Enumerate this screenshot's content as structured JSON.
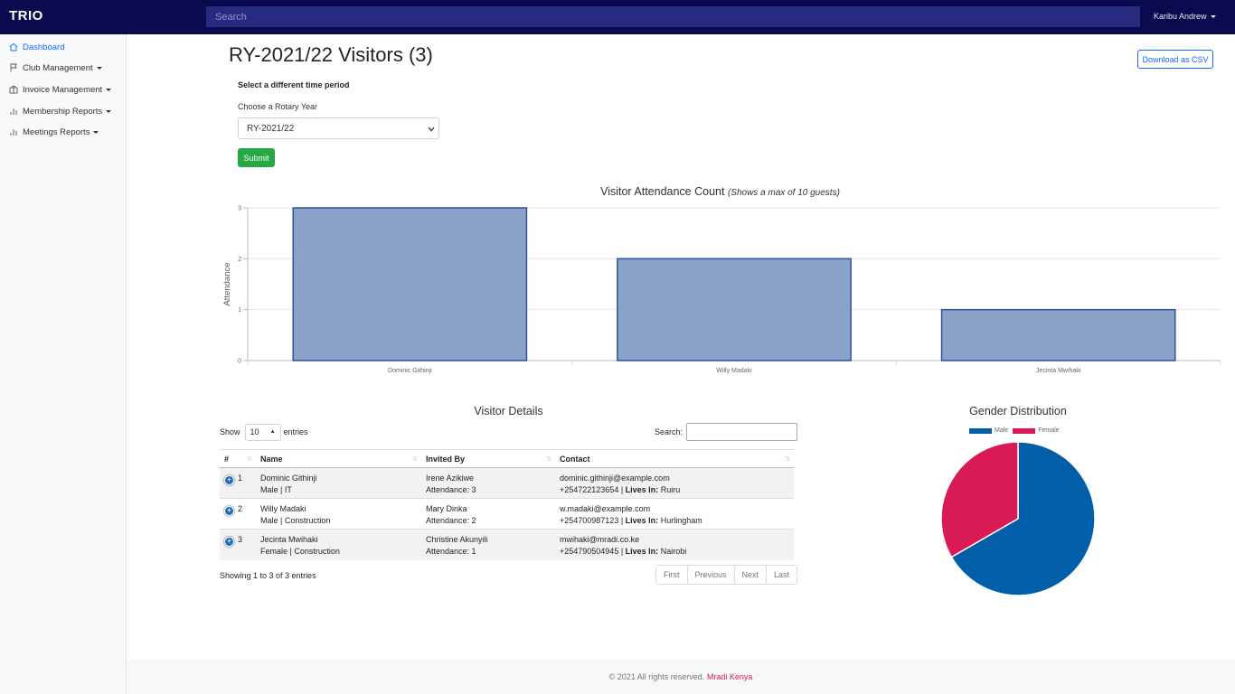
{
  "app": {
    "brand": "TRIO"
  },
  "topbar": {
    "search_placeholder": "Search",
    "user_label": "Karibu Andrew"
  },
  "sidebar": {
    "items": [
      {
        "label": "Dashboard",
        "icon": "home-icon",
        "active": true,
        "dropdown": false
      },
      {
        "label": "Club Management",
        "icon": "flag-icon",
        "active": false,
        "dropdown": true
      },
      {
        "label": "Invoice Management",
        "icon": "briefcase-icon",
        "active": false,
        "dropdown": true
      },
      {
        "label": "Membership Reports",
        "icon": "bar-chart-icon",
        "active": false,
        "dropdown": true
      },
      {
        "label": "Meetings Reports",
        "icon": "bar-chart-icon",
        "active": false,
        "dropdown": true
      }
    ]
  },
  "main": {
    "title": "RY-2021/22 Visitors (3)",
    "download_label": "Download as CSV",
    "period_heading": "Select a different time period",
    "rotary_label": "Choose a Rotary Year",
    "rotary_value": "RY-2021/22",
    "submit_label": "Submit"
  },
  "bar_chart": {
    "title": "Visitor Attendance Count",
    "subtitle": "(Shows a max of 10 guests)"
  },
  "chart_data": [
    {
      "type": "bar",
      "title": "Visitor Attendance Count",
      "subtitle": "(Shows a max of 10 guests)",
      "categories": [
        "Dominic Githinji",
        "Willy Madaki",
        "Jecinta Mwihaki"
      ],
      "values": [
        3,
        2,
        1
      ],
      "xlabel": "",
      "ylabel": "Attendance",
      "ylim": [
        0,
        3
      ],
      "yticks": [
        "0",
        "1",
        "2",
        "3"
      ],
      "grid": true,
      "bar_fill": "#8aa2c8",
      "bar_stroke": "#2f5496"
    },
    {
      "type": "pie",
      "title": "Gender Distribution",
      "labels": [
        "Male",
        "Female"
      ],
      "values": [
        2,
        1
      ],
      "colors": [
        "#015ea9",
        "#d81b55"
      ],
      "legend": "top"
    }
  ],
  "details": {
    "title": "Visitor Details",
    "show_label": "Show",
    "length_value": "10",
    "entries_label": "entries",
    "search_label": "Search:",
    "columns": [
      "#",
      "Name",
      "Invited By",
      "Contact"
    ],
    "rows": [
      {
        "index": "1",
        "name": "Dominic Githinji",
        "meta": "Male | IT",
        "invited_by": "Irene Azikiwe",
        "attendance": "Attendance: 3",
        "email": "dominic.githinji@example.com",
        "phone": "+254722123654",
        "lives_label": "Lives In:",
        "lives": "Ruiru"
      },
      {
        "index": "2",
        "name": "Willy Madaki",
        "meta": "Male | Construction",
        "invited_by": "Mary Dinka",
        "attendance": "Attendance: 2",
        "email": "w.madaki@example.com",
        "phone": "+254700987123",
        "lives_label": "Lives In:",
        "lives": "Hurlingham"
      },
      {
        "index": "3",
        "name": "Jecinta Mwihaki",
        "meta": "Female | Construction",
        "invited_by": "Christine Akunyili",
        "attendance": "Attendance: 1",
        "email": "mwihaki@mradi.co.ke",
        "phone": "+254790504945",
        "lives_label": "Lives In:",
        "lives": "Nairobi"
      }
    ],
    "info": "Showing 1 to 3 of 3 entries",
    "pager": [
      "First",
      "Previous",
      "Next",
      "Last"
    ]
  },
  "pie_chart": {
    "title": "Gender Distribution",
    "legend": [
      "Male",
      "Female"
    ]
  },
  "footer": {
    "text": "© 2021 All rights reserved.",
    "link": "Mradi Kenya"
  }
}
